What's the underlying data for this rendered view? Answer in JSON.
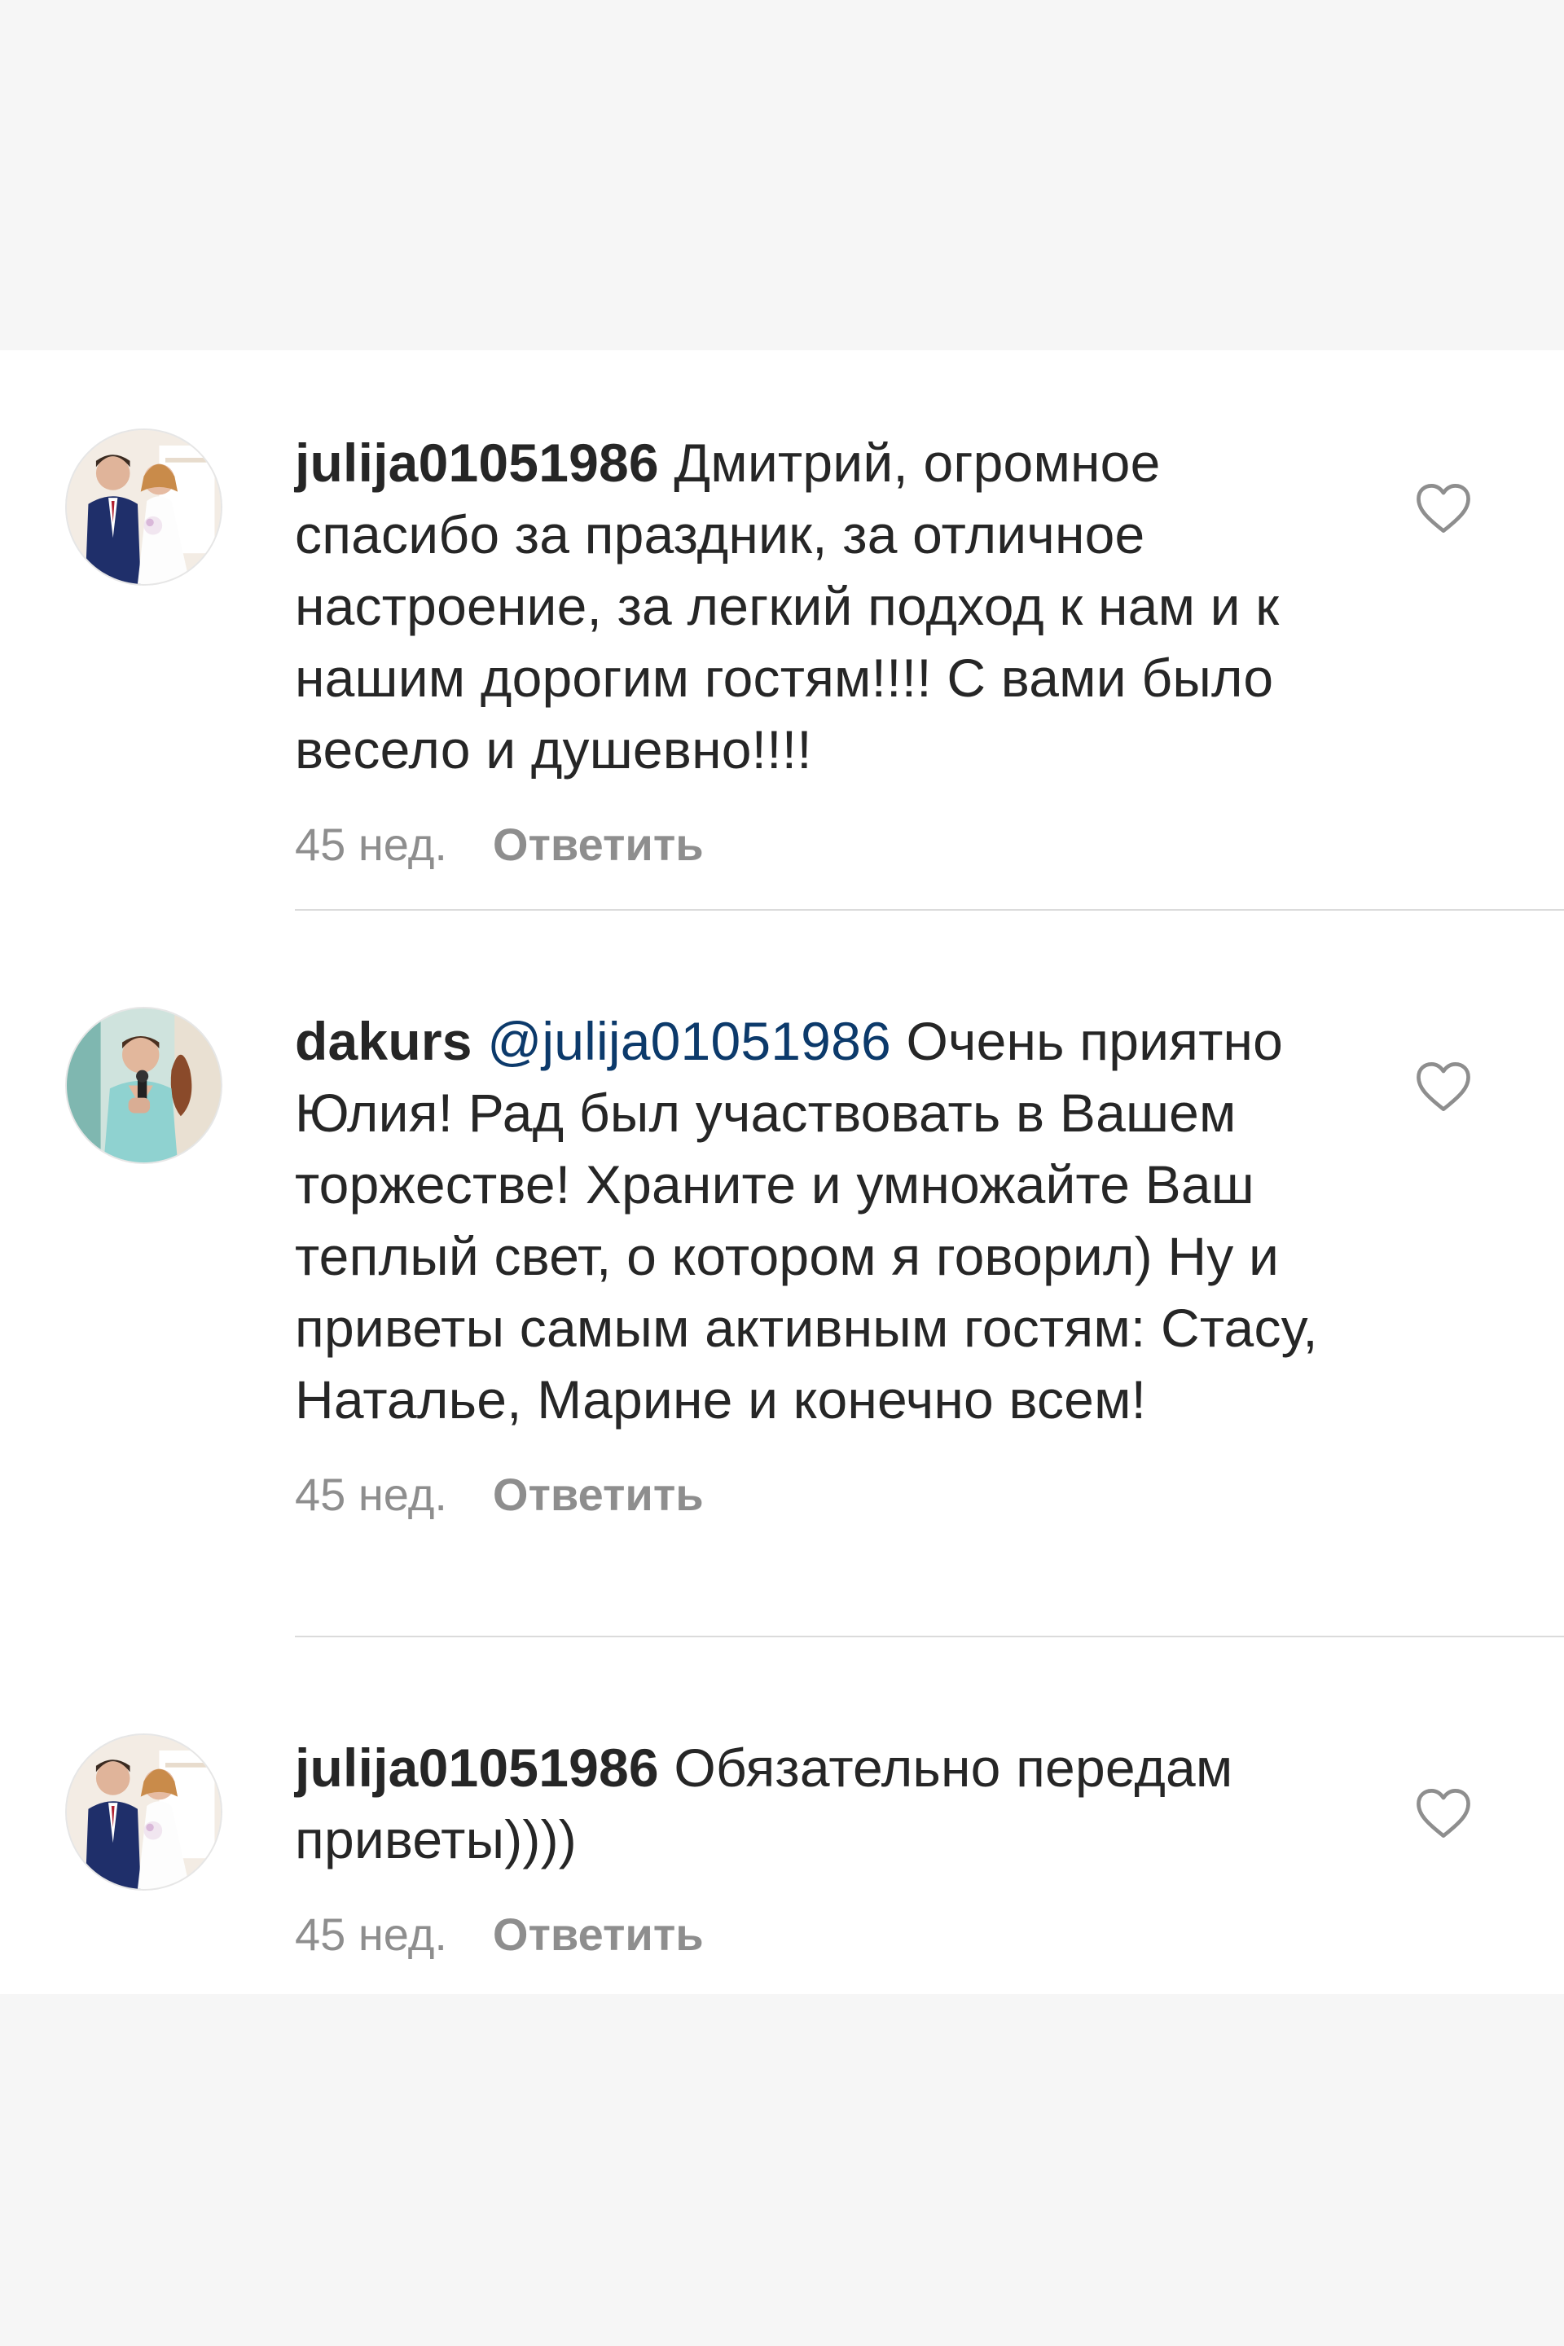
{
  "comments": [
    {
      "username": "julija01051986",
      "mention": "",
      "text": "Дмитрий, огромное спасибо за праздник, за отличное настроение, за легкий подход к нам и к нашим дорогим гостям!!!! С вами было весело и душевно!!!!",
      "time": "45 нед.",
      "reply_label": "Ответить",
      "avatar_icon": "avatar-wedding-couple",
      "like_icon": "heart-outline-icon"
    },
    {
      "username": "dakurs",
      "mention": "@julija01051986",
      "text": "Очень приятно Юлия! Рад был участвовать в Вашем торжестве! Храните и умножайте Ваш теплый свет, о котором я говорил) Ну и приветы самым активным гостям: Стасу, Наталье, Марине и конечно всем!",
      "time": "45 нед.",
      "reply_label": "Ответить",
      "avatar_icon": "avatar-host-with-microphone",
      "like_icon": "heart-outline-icon"
    },
    {
      "username": "julija01051986",
      "mention": "",
      "text": "Обязательно передам приветы))))",
      "time": "45 нед.",
      "reply_label": "Ответить",
      "avatar_icon": "avatar-wedding-couple",
      "like_icon": "heart-outline-icon"
    }
  ],
  "colors": {
    "background": "#f6f6f6",
    "card": "#ffffff",
    "text": "#262626",
    "muted": "#8e8e8e",
    "mention": "#0c3a6b",
    "divider": "#dbdbdb"
  }
}
